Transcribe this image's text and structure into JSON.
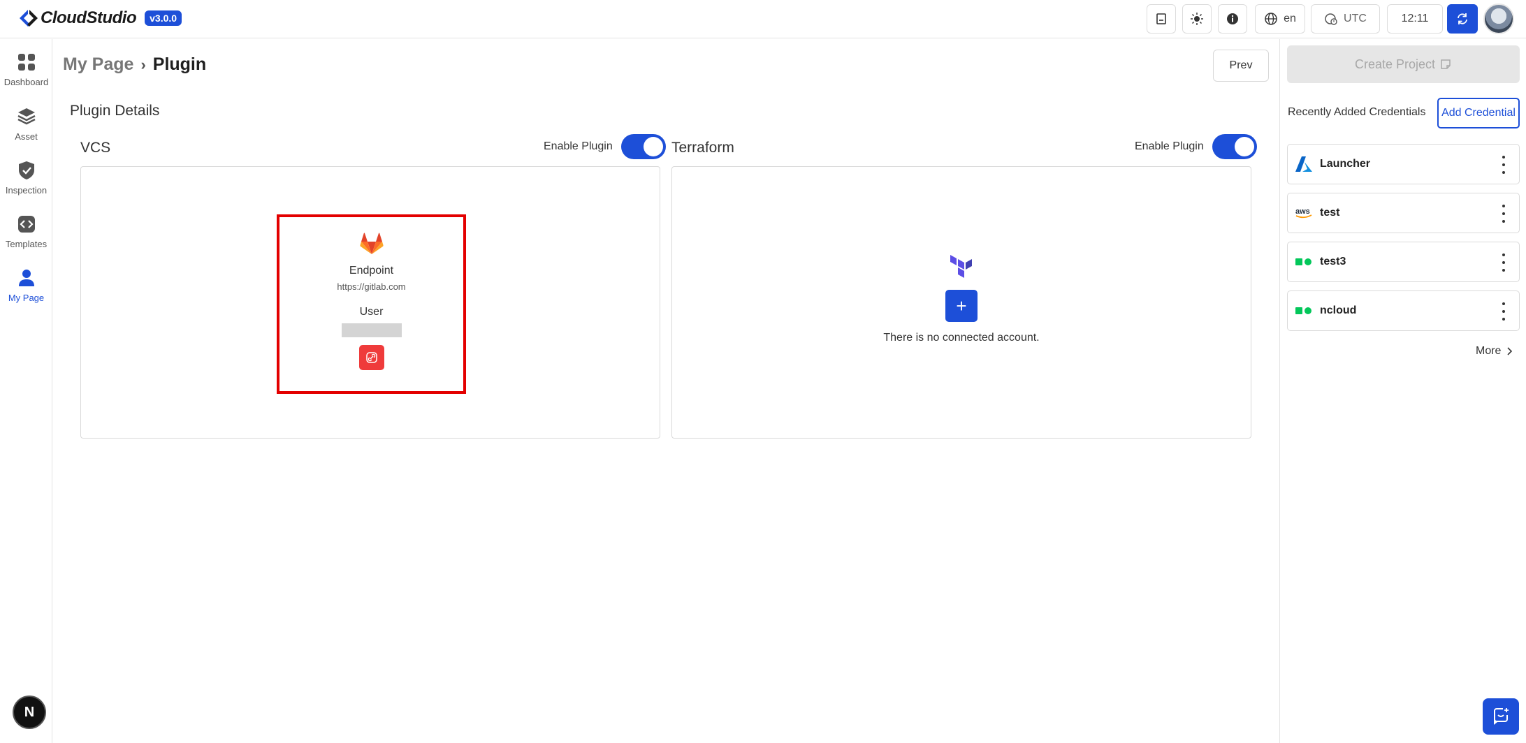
{
  "app": {
    "name": "CloudStudio",
    "version": "v3.0.0"
  },
  "topbar": {
    "language": "en",
    "timezone": "UTC",
    "time": "12:11"
  },
  "sidebar": {
    "items": [
      {
        "label": "Dashboard",
        "icon": "grid-icon"
      },
      {
        "label": "Asset",
        "icon": "layers-icon"
      },
      {
        "label": "Inspection",
        "icon": "shield-check-icon"
      },
      {
        "label": "Templates",
        "icon": "code-icon"
      },
      {
        "label": "My Page",
        "icon": "user-icon",
        "active": true
      }
    ],
    "bottom_badge": "N"
  },
  "breadcrumb": {
    "parent": "My Page",
    "separator": "›",
    "current": "Plugin"
  },
  "prev_label": "Prev",
  "section_title": "Plugin Details",
  "vcs": {
    "title": "VCS",
    "enable_label": "Enable Plugin",
    "enabled": true,
    "provider_icon": "gitlab-icon",
    "endpoint_label": "Endpoint",
    "endpoint_value": "https://gitlab.com",
    "user_label": "User"
  },
  "terraform": {
    "title": "Terraform",
    "enable_label": "Enable Plugin",
    "enabled": true,
    "add_label": "+",
    "empty_text": "There is no connected account."
  },
  "right_panel": {
    "create_project": "Create Project",
    "recent_title": "Recently Added Credentials",
    "add_credential": "Add Credential",
    "credentials": [
      {
        "name": "Launcher",
        "icon": "azure-icon"
      },
      {
        "name": "test",
        "icon": "aws-icon",
        "icon_text": "aws"
      },
      {
        "name": "test3",
        "icon": "ncloud-icon"
      },
      {
        "name": "ncloud",
        "icon": "ncloud-icon"
      }
    ],
    "more_label": "More"
  },
  "colors": {
    "primary": "#1d4fd8",
    "danger": "#ef3b3b",
    "highlight": "#e30000",
    "ncloud": "#03c75a",
    "terraform": "#5c4ee5"
  }
}
